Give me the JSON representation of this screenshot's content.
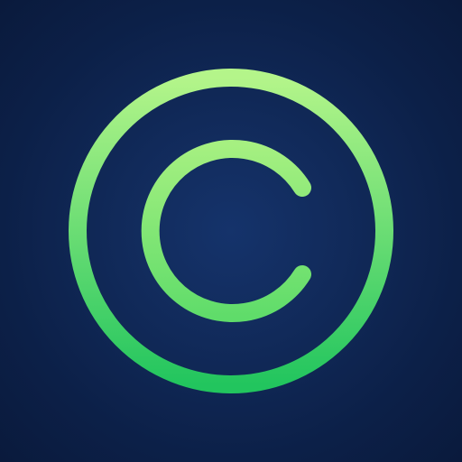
{
  "icon": {
    "name": "copyright-icon",
    "symbol": "©",
    "colors": {
      "background_center": "#15336b",
      "background_edge": "#0a1a3c",
      "stroke_top": "#b4f58a",
      "stroke_bottom": "#22c55e"
    }
  }
}
